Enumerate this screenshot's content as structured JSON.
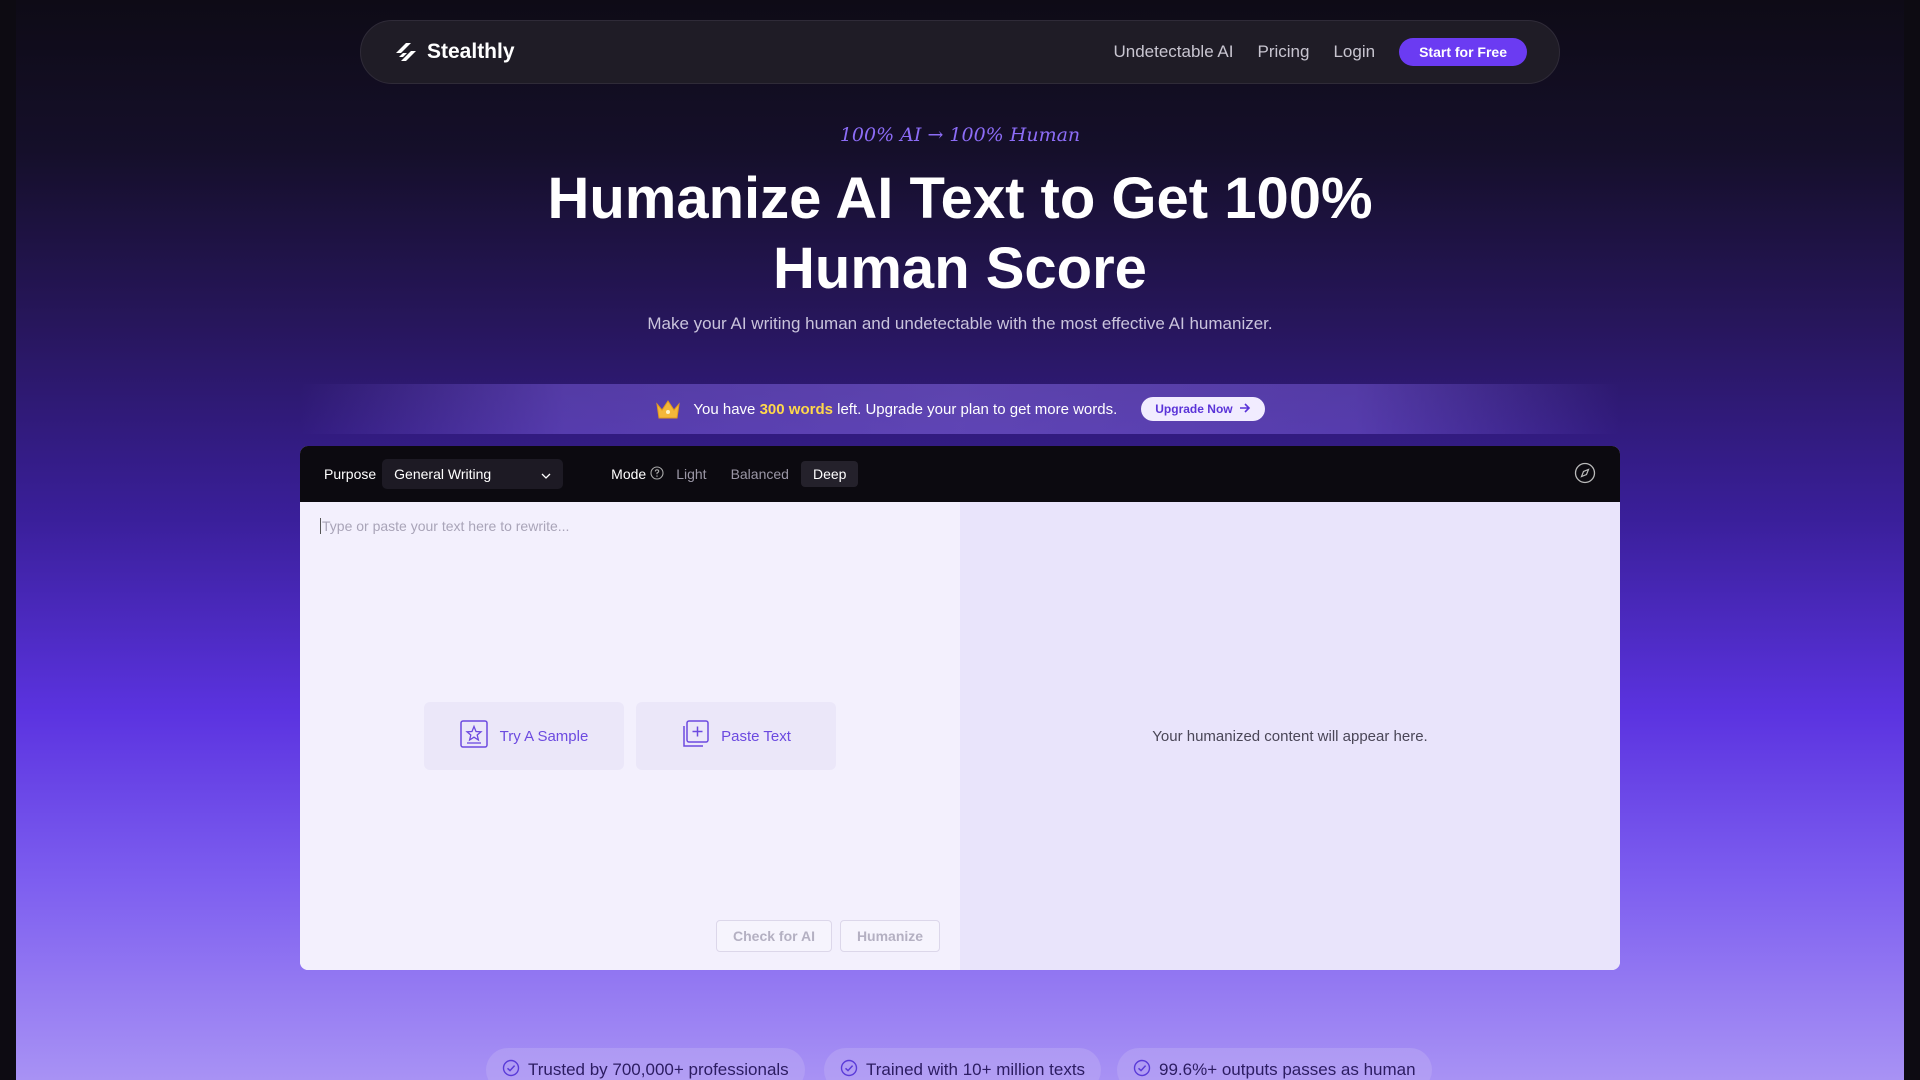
{
  "nav": {
    "brand": "Stealthly",
    "links": [
      "Undetectable AI",
      "Pricing",
      "Login"
    ],
    "cta": "Start for Free"
  },
  "hero": {
    "eyebrow": "100% AI → 100% Human",
    "title": "Humanize AI Text to Get 100% Human Score",
    "subtitle": "Make your AI writing human and undetectable with the most effective AI humanizer."
  },
  "banner": {
    "prefix": "You have ",
    "highlight": "300 words",
    "suffix": " left. Upgrade your plan to get more words.",
    "upgrade": "Upgrade Now",
    "highlight_color": "#ffd84a"
  },
  "toolbar": {
    "purpose_label": "Purpose",
    "purpose_value": "General Writing",
    "mode_label": "Mode",
    "modes": [
      "Light",
      "Balanced",
      "Deep"
    ],
    "active_mode": "Deep"
  },
  "editor": {
    "input_placeholder": "Type or paste your text here to rewrite...",
    "try_sample": "Try A Sample",
    "paste_text": "Paste Text",
    "check_ai": "Check for AI",
    "humanize": "Humanize",
    "output_placeholder": "Your humanized content will appear here."
  },
  "badges": [
    "Trusted by 700,000+ professionals",
    "Trained with 10+ million texts",
    "99.6%+ outputs passes as human"
  ],
  "colors": {
    "accent": "#6b3bf2",
    "eyebrow": "#8c6cf6"
  }
}
